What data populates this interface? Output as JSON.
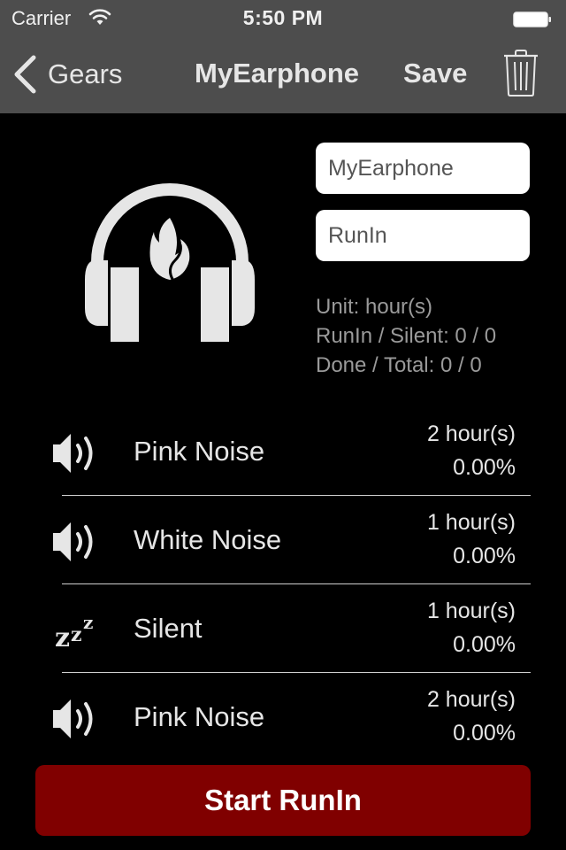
{
  "status_bar": {
    "carrier": "Carrier",
    "time": "5:50 PM",
    "wifi_icon": "wifi-icon",
    "battery_icon": "battery-full-icon"
  },
  "nav": {
    "back_label": "Gears",
    "title": "MyEarphone",
    "save_label": "Save",
    "delete_icon": "trash-icon"
  },
  "hero_icon": "headphones-flame-icon",
  "form": {
    "name_value": "MyEarphone",
    "type_value": "RunIn"
  },
  "summary": {
    "unit": "Unit: hour(s)",
    "runin_silent": "RunIn / Silent: 0 / 0",
    "done_total": "Done / Total: 0 / 0"
  },
  "steps": [
    {
      "icon": "speaker-icon",
      "name": "Pink Noise",
      "duration": "2 hour(s)",
      "progress": "0.00%"
    },
    {
      "icon": "speaker-icon",
      "name": "White Noise",
      "duration": "1 hour(s)",
      "progress": "0.00%"
    },
    {
      "icon": "sleep-zzz-icon",
      "name": "Silent",
      "duration": "1 hour(s)",
      "progress": "0.00%"
    },
    {
      "icon": "speaker-icon",
      "name": "Pink Noise",
      "duration": "2 hour(s)",
      "progress": "0.00%"
    }
  ],
  "start_button": {
    "label": "Start RunIn",
    "color": "#800000"
  },
  "colors": {
    "nav_bg": "#4d4d4d",
    "background": "#000000",
    "text": "#e6e6e6",
    "muted_text": "#9a9a9a"
  }
}
